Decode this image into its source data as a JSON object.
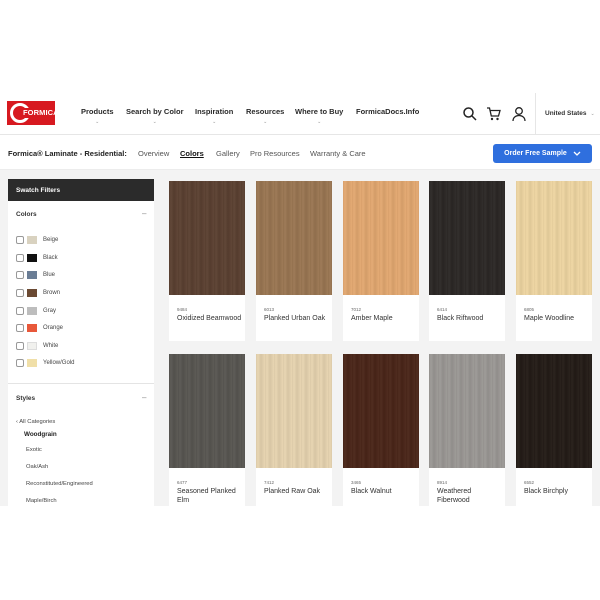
{
  "brand": {
    "logo_text": "FORMICA",
    "accent": "#d71920"
  },
  "header": {
    "nav": [
      "Products",
      "Search by Color",
      "Inspiration",
      "Resources",
      "Where to Buy",
      "FormicaDocs.Info"
    ],
    "country": "United States",
    "icons": [
      "search-icon",
      "cart-icon",
      "account-icon"
    ]
  },
  "subnav": {
    "breadcrumb": "Formica® Laminate - Residential:",
    "tabs": [
      "Overview",
      "Colors",
      "Gallery",
      "Pro Resources",
      "Warranty & Care"
    ],
    "active_tab": "Colors",
    "order_button": "Order Free Sample"
  },
  "sidebar": {
    "title": "Swatch Filters",
    "colors_heading": "Colors",
    "colors": [
      {
        "label": "Beige",
        "color": "#d9d2c0"
      },
      {
        "label": "Black",
        "color": "#111111"
      },
      {
        "label": "Blue",
        "color": "#6a7d95"
      },
      {
        "label": "Brown",
        "color": "#6b4a33"
      },
      {
        "label": "Gray",
        "color": "#bdbdbd"
      },
      {
        "label": "Orange",
        "color": "#e8583a"
      },
      {
        "label": "White",
        "color": "#f1f1ee"
      },
      {
        "label": "Yellow/Gold",
        "color": "#f0dfa8"
      }
    ],
    "styles_heading": "Styles",
    "all_categories": "‹ All Categories",
    "current_category": "Woodgrain",
    "subcategories": [
      "Exotic",
      "Oak/Ash",
      "Reconstituted/Engineered",
      "Maple/Birch"
    ]
  },
  "swatches": [
    {
      "number": "9484",
      "name": "Oxidized Beamwood",
      "color": "#5b4031"
    },
    {
      "number": "6013",
      "name": "Planked Urban Oak",
      "color": "#9a7652"
    },
    {
      "number": "7012",
      "name": "Amber Maple",
      "color": "#e3a870"
    },
    {
      "number": "6414",
      "name": "Black Riftwood",
      "color": "#2b2725"
    },
    {
      "number": "6805",
      "name": "Maple Woodline",
      "color": "#efd6a2"
    },
    {
      "number": "6477",
      "name": "Seasoned Planked Elm",
      "color": "#585651"
    },
    {
      "number": "7412",
      "name": "Planked Raw Oak",
      "color": "#e7d4b0"
    },
    {
      "number": "3465",
      "name": "Black Walnut",
      "color": "#4a2518"
    },
    {
      "number": "8914",
      "name": "Weathered Fiberwood",
      "color": "#9b9895"
    },
    {
      "number": "6552",
      "name": "Black Birchply",
      "color": "#231b16"
    }
  ]
}
